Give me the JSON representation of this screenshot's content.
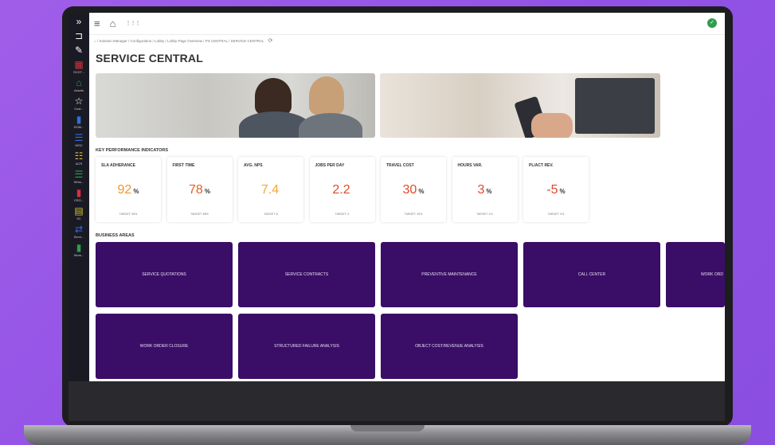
{
  "nav": {
    "items": [
      {
        "glyph": "»",
        "label": ""
      },
      {
        "glyph": "⊐",
        "label": ""
      },
      {
        "glyph": "✎",
        "label": ""
      },
      {
        "glyph": "▦",
        "label": "SCDT..."
      },
      {
        "glyph": "⌂",
        "label": "Assets"
      },
      {
        "glyph": "☆",
        "label": "Cust..."
      },
      {
        "glyph": "▮",
        "label": "DOM..."
      },
      {
        "glyph": "☰",
        "label": "WSC"
      },
      {
        "glyph": "☷",
        "label": "ACR"
      },
      {
        "glyph": "☰",
        "label": "Wms..."
      },
      {
        "glyph": "▮",
        "label": "CRO..."
      },
      {
        "glyph": "▤",
        "label": "SC"
      },
      {
        "glyph": "⇄",
        "label": "Servi..."
      },
      {
        "glyph": "▮",
        "label": "Work..."
      }
    ],
    "colors": [
      "#ffffff",
      "#ffffff",
      "#ffffff",
      "#d9303e",
      "#2e9e4a",
      "#ffffff",
      "#2f6fd6",
      "#2f6fd6",
      "#d6c230",
      "#2e9e4a",
      "#d9303e",
      "#d6c230",
      "#2f6fd6",
      "#2e9e4a"
    ]
  },
  "toolbar": {
    "menu_icon": "≡",
    "home_icon": "⌂",
    "apps_icon": "⋮⋮⋮",
    "avatar_glyph": "✓"
  },
  "breadcrumb": {
    "text": "⌂ / Solution Manager / Configuration / Lobby / Lobby Page Overview / PS CENTRAL / SERVICE CENTRAL",
    "refresh_glyph": "⟳"
  },
  "page": {
    "title": "SERVICE CENTRAL"
  },
  "kpi_section_label": "KEY PERFORMANCE INDICATORS",
  "kpis": [
    {
      "name": "SLA ADHERANCE",
      "value": "92",
      "unit": "%",
      "target": "TARGET: 95%",
      "color": "#f0962a"
    },
    {
      "name": "FIRST TIME",
      "value": "78",
      "unit": "%",
      "target": "TARGET: 85%",
      "color": "#e0602a"
    },
    {
      "name": "AVG. NPS",
      "value": "7.4",
      "unit": "",
      "target": "TARGET: 8",
      "color": "#f0a83a"
    },
    {
      "name": "JOBS PER DAY",
      "value": "2.2",
      "unit": "",
      "target": "TARGET: 3",
      "color": "#e04a2a"
    },
    {
      "name": "TRAVEL COST",
      "value": "30",
      "unit": "%",
      "target": "TARGET: 20%",
      "color": "#e04a2a"
    },
    {
      "name": "HOURS VAR.",
      "value": "3",
      "unit": "%",
      "target": "TARGET: 1%",
      "color": "#e04a2a"
    },
    {
      "name": "PL/ACT REV.",
      "value": "-5",
      "unit": "%",
      "target": "TARGET: 0%",
      "color": "#e04a2a"
    }
  ],
  "business_section_label": "BUSINESS AREAS",
  "business_areas": [
    {
      "label": "SERVICE QUOTATIONS"
    },
    {
      "label": "SERVICE CONTRACTS"
    },
    {
      "label": "PREVENTIVE MAINTENANCE"
    },
    {
      "label": "CALL CENTER"
    },
    {
      "label": "WORK ORD"
    },
    {
      "label": "WORK ORDER CLOSURE"
    },
    {
      "label": "STRUCTURED FAILURE ANALYSIS"
    },
    {
      "label": "OBJECT COST/REVENUE ANALYSIS"
    }
  ],
  "colors": {
    "tile_bg": "#3a0d66",
    "nav_bg": "#1a1a24",
    "page_bg": "#9252e6"
  }
}
